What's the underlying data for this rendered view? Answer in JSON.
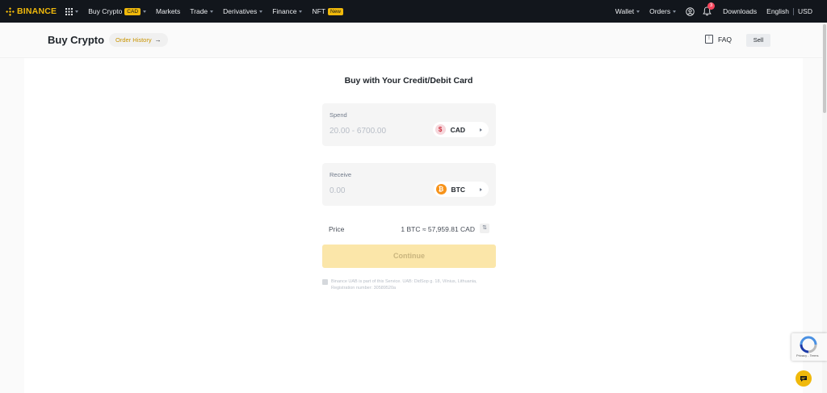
{
  "topnav": {
    "logo_text": "BINANCE",
    "items": [
      {
        "label": "Buy Crypto",
        "badge": "CAD",
        "has_caret": true
      },
      {
        "label": "Markets",
        "has_caret": false
      },
      {
        "label": "Trade",
        "has_caret": true
      },
      {
        "label": "Derivatives",
        "has_caret": true
      },
      {
        "label": "Finance",
        "has_caret": true
      },
      {
        "label": "NFT",
        "badge": "New",
        "has_caret": false
      }
    ],
    "right": {
      "wallet": "Wallet",
      "orders": "Orders",
      "notification_count": "3",
      "downloads": "Downloads",
      "language": "English",
      "currency": "USD"
    }
  },
  "header": {
    "title": "Buy Crypto",
    "order_history": "Order History",
    "faq": "FAQ",
    "sell": "Sell"
  },
  "card": {
    "title": "Buy with Your Credit/Debit Card",
    "spend": {
      "label": "Spend",
      "placeholder": "20.00 - 6700.00",
      "currency": "CAD",
      "currency_symbol": "$"
    },
    "receive": {
      "label": "Receive",
      "placeholder": "0.00",
      "currency": "BTC",
      "currency_symbol": "₿"
    },
    "price": {
      "label": "Price",
      "value": "1 BTC ≈ 57,959.81 CAD"
    },
    "continue": "Continue",
    "disclaimer": "Binance UAB is part of this Service. UAB: DidSop g. 18, Vilnius, Lithuania, Registration number: 30589520a"
  },
  "colors": {
    "brand": "#f0b90b",
    "nav_bg": "#12161c",
    "continue_disabled_bg": "#fbe6a9"
  }
}
